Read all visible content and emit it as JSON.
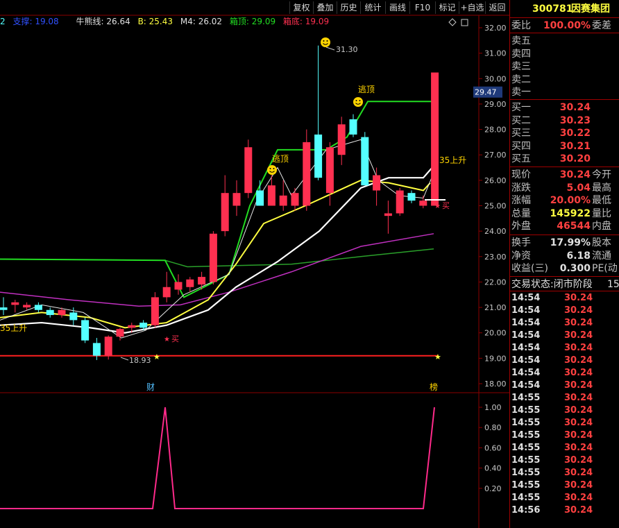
{
  "toolbar": {
    "buttons": [
      "复权",
      "叠加",
      "历史",
      "统计",
      "画线",
      "F10",
      "标记",
      "+自选",
      "返回"
    ]
  },
  "legend": {
    "prefix": "2",
    "support": "支撑: 19.08",
    "bull_line": "牛熊线: 26.64",
    "b_value": "B: 25.43",
    "m4": "M4: 26.02",
    "box_top": "箱顶: 29.09",
    "box_bottom": "箱底: 19.09"
  },
  "colors": {
    "up": "#ff3050",
    "down": "#54ffff",
    "green_line": "#22dd22",
    "yellow_line": "#ffff40",
    "white_line": "#ffffff",
    "magenta_line": "#c030c0",
    "dark_green_line": "#2aa02a",
    "red_line": "#ff2020",
    "indicator": "#ff2a8a",
    "grid": "#8b0000"
  },
  "price_axis": {
    "ticks": [
      "32.00",
      "31.00",
      "30.00",
      "29.00",
      "28.00",
      "27.00",
      "26.00",
      "25.00",
      "24.00",
      "23.00",
      "22.00",
      "21.00",
      "20.00",
      "19.00",
      "18.00"
    ],
    "current_tag": "29.47"
  },
  "indicator_axis": {
    "ticks": [
      "1.00",
      "0.80",
      "0.60",
      "0.40",
      "0.20"
    ]
  },
  "annotations": {
    "high_label": "31.30",
    "low_label": "18.93",
    "escape_top_1": "逃顶",
    "escape_top_2": "逃顶",
    "rise_35_left": "35上升",
    "rise_35_right": "35上升",
    "buy_left": "买",
    "buy_right": "买",
    "event_cai": "财",
    "event_bang": "榜"
  },
  "chart_data": {
    "type": "candlestick",
    "ylim": [
      17.8,
      32.2
    ],
    "candles": [
      [
        21.0,
        21.4,
        20.7,
        20.9
      ],
      [
        21.1,
        21.3,
        20.8,
        21.2
      ],
      [
        21.0,
        21.2,
        20.9,
        21.1
      ],
      [
        21.1,
        21.2,
        20.8,
        20.9
      ],
      [
        20.9,
        21.0,
        20.6,
        20.7
      ],
      [
        20.7,
        21.0,
        20.6,
        20.9
      ],
      [
        20.8,
        21.0,
        20.3,
        20.5
      ],
      [
        20.5,
        20.6,
        19.6,
        19.7
      ],
      [
        19.6,
        19.8,
        18.93,
        19.1
      ],
      [
        19.1,
        19.9,
        18.95,
        19.85
      ],
      [
        19.85,
        20.2,
        19.7,
        20.15
      ],
      [
        20.2,
        20.4,
        20.0,
        20.3
      ],
      [
        20.4,
        20.5,
        20.1,
        20.2
      ],
      [
        20.3,
        21.6,
        20.2,
        21.4
      ],
      [
        21.4,
        22.4,
        21.2,
        21.8
      ],
      [
        21.7,
        22.3,
        21.5,
        22.0
      ],
      [
        21.8,
        22.2,
        21.6,
        22.1
      ],
      [
        21.9,
        22.4,
        21.7,
        22.2
      ],
      [
        22.0,
        24.0,
        21.9,
        23.9
      ],
      [
        24.0,
        26.2,
        23.8,
        25.5
      ],
      [
        25.0,
        26.0,
        24.6,
        25.5
      ],
      [
        25.5,
        27.6,
        25.3,
        27.3
      ],
      [
        25.6,
        26.0,
        25.0,
        25.0
      ],
      [
        25.0,
        26.2,
        25.0,
        25.8
      ],
      [
        25.0,
        26.0,
        24.8,
        25.4
      ],
      [
        25.0,
        25.7,
        24.8,
        25.5
      ],
      [
        25.0,
        28.0,
        24.8,
        27.5
      ],
      [
        27.8,
        31.3,
        26.0,
        26.1
      ],
      [
        25.5,
        27.5,
        25.0,
        27.3
      ],
      [
        27.0,
        28.5,
        26.6,
        28.2
      ],
      [
        28.4,
        28.6,
        27.7,
        27.8
      ],
      [
        27.7,
        27.9,
        26.0,
        25.8
      ],
      [
        25.6,
        26.5,
        25.0,
        26.2
      ],
      [
        24.6,
        25.2,
        23.9,
        24.7
      ],
      [
        24.7,
        25.7,
        24.6,
        25.6
      ],
      [
        25.5,
        25.6,
        25.1,
        25.2
      ],
      [
        25.0,
        25.4,
        24.9,
        25.2
      ],
      [
        25.0,
        30.24,
        25.0,
        30.24
      ]
    ],
    "indicator": [
      0,
      0,
      0,
      0,
      0,
      0,
      0,
      0,
      0,
      0,
      0,
      0,
      0,
      0,
      1,
      0,
      0,
      0,
      0,
      0,
      0,
      0,
      0,
      0,
      0,
      0,
      0,
      0,
      0,
      0,
      0,
      0,
      0,
      0,
      0,
      0,
      0,
      1
    ],
    "indicator_ylim": [
      0,
      1
    ]
  },
  "right_panel": {
    "stock_code": "300781",
    "stock_name": "因赛集团",
    "webi_label": "委比",
    "webi_value": "100.00%",
    "weicha_label": "委差",
    "sell_labels": [
      "卖五",
      "卖四",
      "卖三",
      "卖二",
      "卖一"
    ],
    "buy_labels": [
      "买一",
      "买二",
      "买三",
      "买四",
      "买五"
    ],
    "buy_prices": [
      "30.24",
      "30.23",
      "30.22",
      "30.21",
      "30.20"
    ],
    "stats": [
      {
        "label": "现价",
        "value": "30.24",
        "label2": "今开",
        "color": "#ff4040"
      },
      {
        "label": "涨跌",
        "value": "5.04",
        "label2": "最高",
        "color": "#ff4040"
      },
      {
        "label": "涨幅",
        "value": "20.00%",
        "label2": "最低",
        "color": "#ff4040"
      },
      {
        "label": "总量",
        "value": "145922",
        "label2": "量比",
        "color": "#ffff40"
      },
      {
        "label": "外盘",
        "value": "46544",
        "label2": "内盘",
        "color": "#ff4040"
      }
    ],
    "stats2": [
      {
        "label": "换手",
        "value": "17.99%",
        "label2": "股本",
        "color": "#e0e0e0"
      },
      {
        "label": "净资",
        "value": "6.18",
        "label2": "流通",
        "color": "#e0e0e0"
      },
      {
        "label": "收益(三)",
        "value": "0.300",
        "label2": "PE(动",
        "color": "#e0e0e0"
      }
    ],
    "trade_status": "交易状态:闭市阶段",
    "trade_status_num": "15",
    "ticks": [
      {
        "time": "14:54",
        "price": "30.24"
      },
      {
        "time": "14:54",
        "price": "30.24"
      },
      {
        "time": "14:54",
        "price": "30.24"
      },
      {
        "time": "14:54",
        "price": "30.24"
      },
      {
        "time": "14:54",
        "price": "30.24"
      },
      {
        "time": "14:54",
        "price": "30.24"
      },
      {
        "time": "14:54",
        "price": "30.24"
      },
      {
        "time": "14:54",
        "price": "30.24"
      },
      {
        "time": "14:55",
        "price": "30.24"
      },
      {
        "time": "14:55",
        "price": "30.24"
      },
      {
        "time": "14:55",
        "price": "30.24"
      },
      {
        "time": "14:55",
        "price": "30.24"
      },
      {
        "time": "14:55",
        "price": "30.24"
      },
      {
        "time": "14:55",
        "price": "30.24"
      },
      {
        "time": "14:55",
        "price": "30.24"
      },
      {
        "time": "14:55",
        "price": "30.24"
      },
      {
        "time": "14:55",
        "price": "30.24"
      },
      {
        "time": "14:56",
        "price": "30.24"
      }
    ]
  }
}
